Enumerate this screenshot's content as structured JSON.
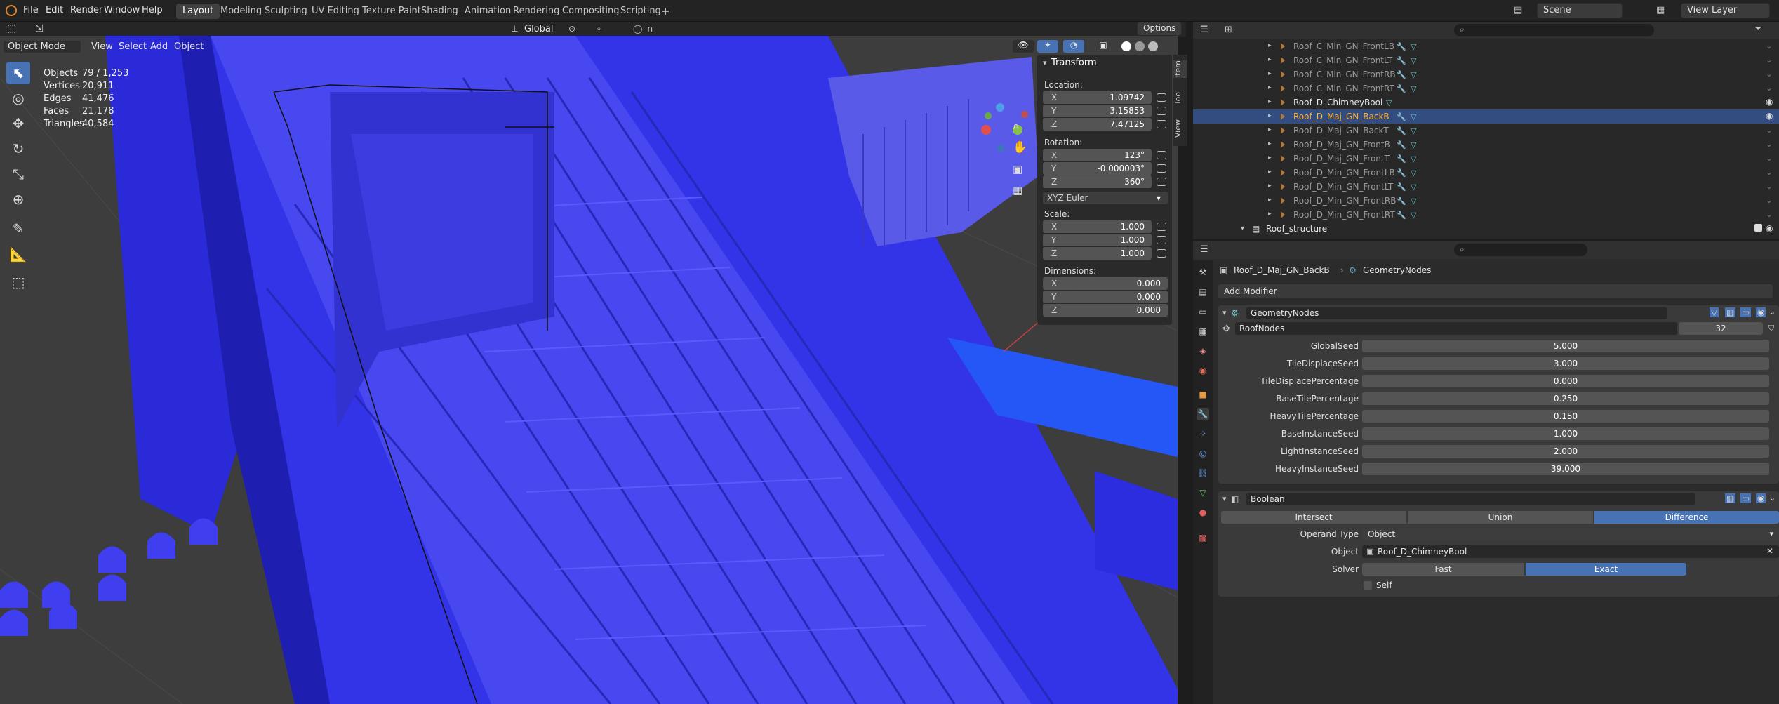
{
  "menu": [
    "File",
    "Edit",
    "Render",
    "Window",
    "Help"
  ],
  "workspaces": [
    "Layout",
    "Modeling",
    "Sculpting",
    "UV Editing",
    "Texture Paint",
    "Shading",
    "Animation",
    "Rendering",
    "Compositing",
    "Scripting"
  ],
  "active_workspace": "Layout",
  "orientation": {
    "label": "Global"
  },
  "options_label": "Options",
  "scene": {
    "label": "Scene"
  },
  "view_layer": {
    "label": "View Layer"
  },
  "viewport_header": {
    "mode": "Object Mode",
    "menus": [
      "View",
      "Select",
      "Add",
      "Object"
    ]
  },
  "stats": [
    {
      "k": "Objects",
      "v": "79 / 1,253"
    },
    {
      "k": "Vertices",
      "v": "20,911"
    },
    {
      "k": "Edges",
      "v": "41,476"
    },
    {
      "k": "Faces",
      "v": "21,178"
    },
    {
      "k": "Triangles",
      "v": "40,584"
    }
  ],
  "npanel": {
    "title": "Transform",
    "location_label": "Location:",
    "location": [
      {
        "ax": "X",
        "v": "1.09742"
      },
      {
        "ax": "Y",
        "v": "3.15853"
      },
      {
        "ax": "Z",
        "v": "7.47125"
      }
    ],
    "rotation_label": "Rotation:",
    "rotation": [
      {
        "ax": "X",
        "v": "123°"
      },
      {
        "ax": "Y",
        "v": "-0.000003°"
      },
      {
        "ax": "Z",
        "v": "360°"
      }
    ],
    "rotation_mode": "XYZ Euler",
    "scale_label": "Scale:",
    "scale": [
      {
        "ax": "X",
        "v": "1.000"
      },
      {
        "ax": "Y",
        "v": "1.000"
      },
      {
        "ax": "Z",
        "v": "1.000"
      }
    ],
    "dimensions_label": "Dimensions:",
    "dimensions": [
      {
        "ax": "X",
        "v": "0.000"
      },
      {
        "ax": "Y",
        "v": "0.000"
      },
      {
        "ax": "Z",
        "v": "0.000"
      }
    ],
    "tabs": [
      "Item",
      "Tool",
      "View"
    ]
  },
  "outliner": [
    {
      "name": "Roof_C_Min_GN_FrontLB",
      "state": "dim"
    },
    {
      "name": "Roof_C_Min_GN_FrontLT",
      "state": "dim"
    },
    {
      "name": "Roof_C_Min_GN_FrontRB",
      "state": "dim"
    },
    {
      "name": "Roof_C_Min_GN_FrontRT",
      "state": "dim"
    },
    {
      "name": "Roof_D_ChimneyBool",
      "state": "vis"
    },
    {
      "name": "Roof_D_Maj_GN_BackB",
      "state": "sel"
    },
    {
      "name": "Roof_D_Maj_GN_BackT",
      "state": "dim"
    },
    {
      "name": "Roof_D_Maj_GN_FrontB",
      "state": "dim"
    },
    {
      "name": "Roof_D_Maj_GN_FrontT",
      "state": "dim"
    },
    {
      "name": "Roof_D_Min_GN_FrontLB",
      "state": "dim"
    },
    {
      "name": "Roof_D_Min_GN_FrontLT",
      "state": "dim"
    },
    {
      "name": "Roof_D_Min_GN_FrontRB",
      "state": "dim"
    },
    {
      "name": "Roof_D_Min_GN_FrontRT",
      "state": "dim"
    },
    {
      "name": "Roof_structure",
      "state": "collection"
    }
  ],
  "properties": {
    "breadcrumb_object": "Roof_D_Maj_GN_BackB",
    "breadcrumb_modifier": "GeometryNodes",
    "add_modifier": "Add Modifier",
    "gn": {
      "name": "GeometryNodes",
      "node_group": "RoofNodes",
      "users": "32",
      "inputs": [
        {
          "label": "GlobalSeed",
          "value": "5.000"
        },
        {
          "label": "TileDisplaceSeed",
          "value": "3.000"
        },
        {
          "label": "TileDisplacePercentage",
          "value": "0.000"
        },
        {
          "label": "BaseTilePercentage",
          "value": "0.250"
        },
        {
          "label": "HeavyTilePercentage",
          "value": "0.150"
        },
        {
          "label": "BaseInstanceSeed",
          "value": "1.000"
        },
        {
          "label": "LightInstanceSeed",
          "value": "2.000"
        },
        {
          "label": "HeavyInstanceSeed",
          "value": "39.000"
        }
      ]
    },
    "boolean": {
      "name": "Boolean",
      "ops": [
        "Intersect",
        "Union",
        "Difference"
      ],
      "active_op": "Difference",
      "operand_label": "Operand Type",
      "operand": "Object",
      "object_label": "Object",
      "object": "Roof_D_ChimneyBool",
      "solver_label": "Solver",
      "solvers": [
        "Fast",
        "Exact"
      ],
      "active_solver": "Exact",
      "self_label": "Self"
    }
  },
  "colors": {
    "accent": "#4772b3",
    "selected_row": "#334d80",
    "active_name": "#ffaf29",
    "mesh": "#2a2af5"
  }
}
